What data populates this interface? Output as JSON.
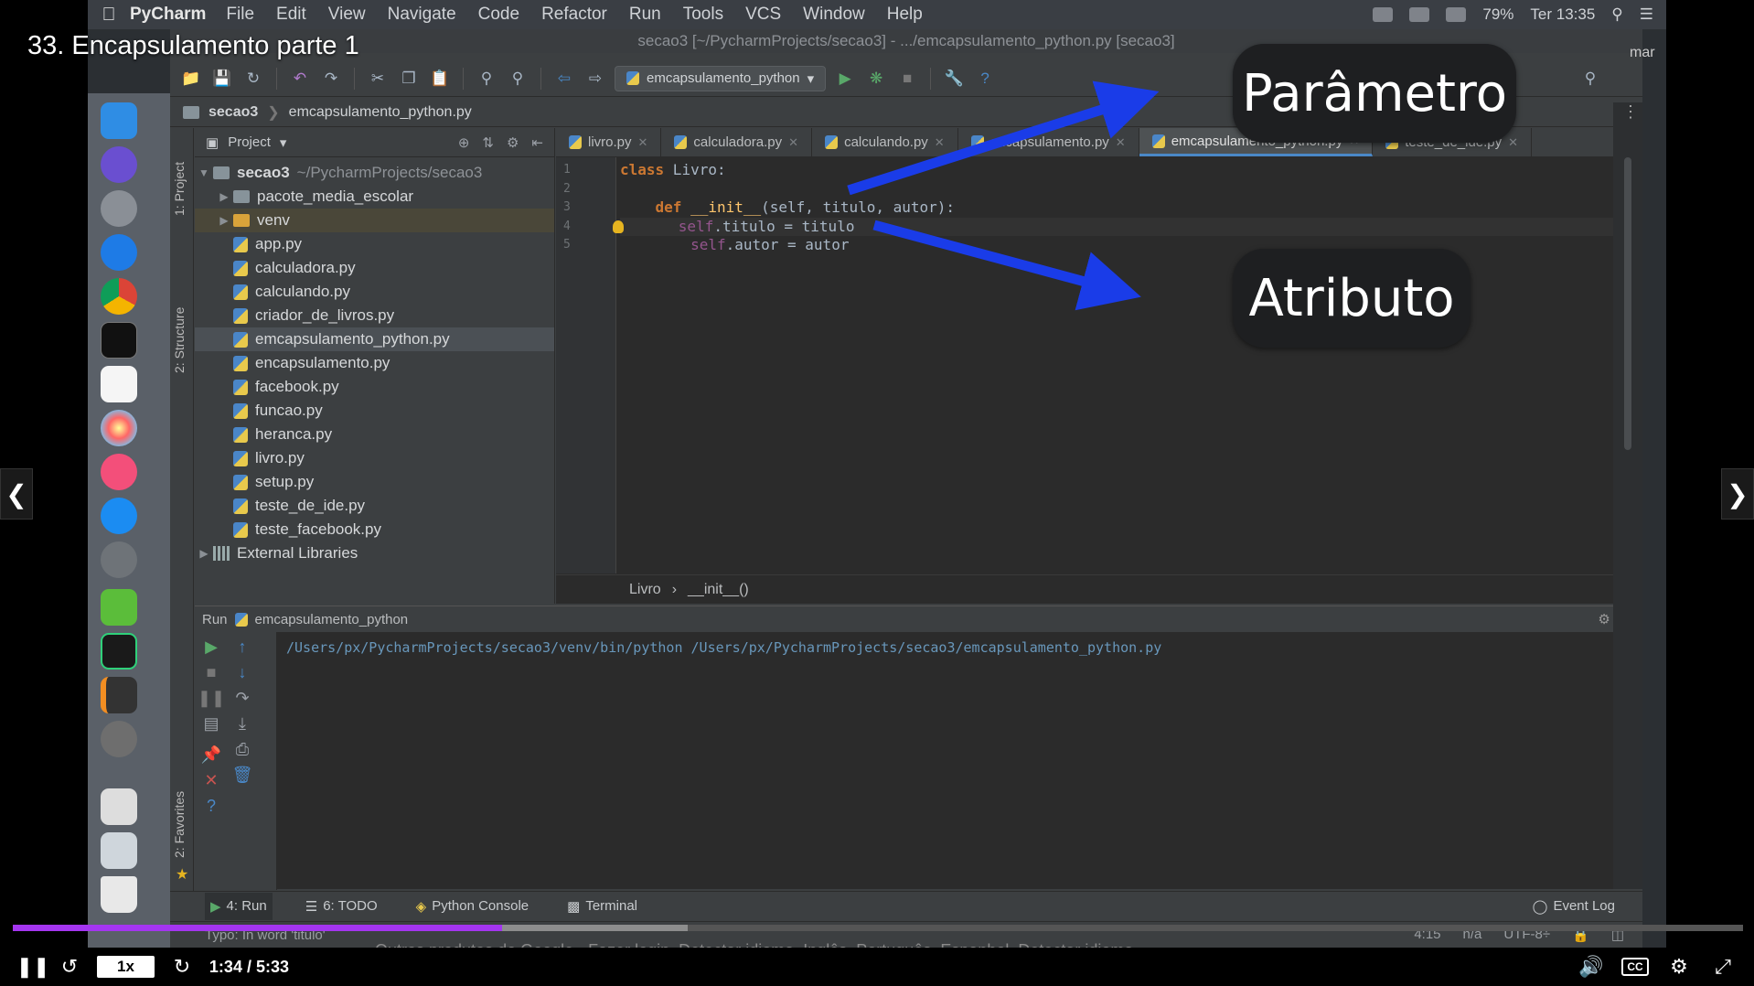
{
  "video": {
    "title": "33. Encapsulamento parte 1",
    "top_right_label": "mar",
    "time": "1:34 / 5:33",
    "speed": "1x",
    "progress_played": 0.283,
    "progress_buffered": 0.39,
    "cc_label": "CC",
    "subtitle_ghost": "Outros produtos do Google · Fazer login. Detectar idioma. Inglês. Português. Espanhol. Detectar idioma. Português. Inglês. Espanhol."
  },
  "menubar": {
    "app": "PyCharm",
    "items": [
      "File",
      "Edit",
      "View",
      "Navigate",
      "Code",
      "Refactor",
      "Run",
      "Tools",
      "VCS",
      "Window",
      "Help"
    ],
    "battery": "79%",
    "clock": "Ter 13:35"
  },
  "ide": {
    "window_title": "secao3 [~/PycharmProjects/secao3] - .../emcapsulamento_python.py [secao3]",
    "run_config": "emcapsulamento_python",
    "breadcrumb": [
      "secao3",
      "emcapsulamento_python.py"
    ],
    "project_header": "Project",
    "side_labels": {
      "project": "1: Project",
      "structure": "2: Structure",
      "favorites": "2: Favorites"
    },
    "tree": {
      "root": "secao3",
      "root_path": "~/PycharmProjects/secao3",
      "folders": [
        "pacote_media_escolar",
        "venv"
      ],
      "files": [
        "app.py",
        "calculadora.py",
        "calculando.py",
        "criador_de_livros.py",
        "emcapsulamento_python.py",
        "encapsulamento.py",
        "facebook.py",
        "funcao.py",
        "heranca.py",
        "livro.py",
        "setup.py",
        "teste_de_ide.py",
        "teste_facebook.py"
      ],
      "external": "External Libraries"
    },
    "tabs": [
      "livro.py",
      "calculadora.py",
      "calculando.py",
      "encapsulamento.py",
      "emcapsulamento_python.py",
      "teste_de_ide.py"
    ],
    "line_numbers": [
      "1",
      "2",
      "3",
      "4",
      "5"
    ],
    "code": {
      "l1_kw": "class",
      "l1_rest": " Livro:",
      "l3_kw": "def",
      "l3_fn": "__init__",
      "l3_rest": "(self, titulo, autor):",
      "l4_self": "self",
      "l4_rest": ".titulo = titulo",
      "l5_self": "self",
      "l5_rest": ".autor = autor"
    },
    "editor_crumb": [
      "Livro",
      "__init__()"
    ],
    "run_panel": {
      "label": "Run",
      "config": "emcapsulamento_python",
      "output": "/Users/px/PycharmProjects/secao3/venv/bin/python /Users/px/PycharmProjects/secao3/emcapsulamento_python.py"
    },
    "tool_tabs": [
      "4: Run",
      "6: TODO",
      "Python Console",
      "Terminal"
    ],
    "event_log": "Event Log",
    "status_left": "Typo: In word 'titulo'",
    "status_right": [
      "4:15",
      "n/a",
      "UTF-8÷"
    ]
  },
  "annotations": {
    "parametro": "Parâmetro",
    "atributo": "Atributo"
  },
  "colors": {
    "accent_progress": "#a435f0",
    "arrow": "#1a3ce8",
    "keyword": "#cc7832",
    "function": "#ffc66d"
  }
}
